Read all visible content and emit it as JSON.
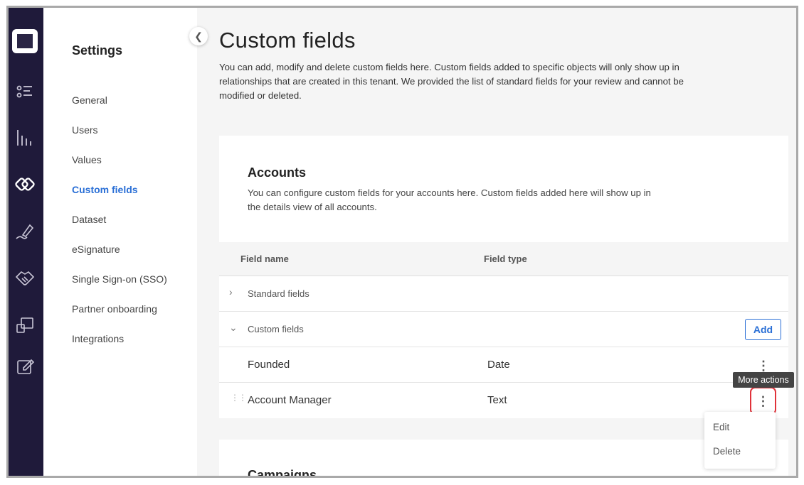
{
  "colors": {
    "rail": "#1f1a3a",
    "accent": "#2a6fd6",
    "highlight": "#e0323a"
  },
  "rail": {
    "icons": [
      "app-logo-icon",
      "checklist-icon",
      "bar-chart-icon",
      "partnership-icon",
      "pen-signature-icon",
      "handshake-icon",
      "screens-icon",
      "edit-note-icon"
    ]
  },
  "sidebar": {
    "title": "Settings",
    "items": [
      {
        "label": "General"
      },
      {
        "label": "Users"
      },
      {
        "label": "Values"
      },
      {
        "label": "Custom fields",
        "active": true
      },
      {
        "label": "Dataset"
      },
      {
        "label": "eSignature"
      },
      {
        "label": "Single Sign-on (SSO)"
      },
      {
        "label": "Partner onboarding"
      },
      {
        "label": "Integrations"
      }
    ]
  },
  "main": {
    "title": "Custom fields",
    "description": "You can add, modify and delete custom fields here. Custom fields added to specific objects will only show up in relationships that are created in this tenant. We provided the list of standard fields for your review and cannot be modified or deleted."
  },
  "accounts": {
    "title": "Accounts",
    "description": "You can configure custom fields for your accounts here. Custom fields added here will show up in the details view of all accounts.",
    "columns": {
      "field_name": "Field name",
      "field_type": "Field type"
    },
    "groups": {
      "standard": "Standard fields",
      "custom": "Custom fields"
    },
    "add_label": "Add",
    "rows": [
      {
        "name": "Founded",
        "type": "Date"
      },
      {
        "name": "Account Manager",
        "type": "Text"
      }
    ]
  },
  "tooltip": "More actions",
  "menu": {
    "edit": "Edit",
    "delete": "Delete"
  },
  "campaigns": {
    "title": "Campaigns"
  }
}
